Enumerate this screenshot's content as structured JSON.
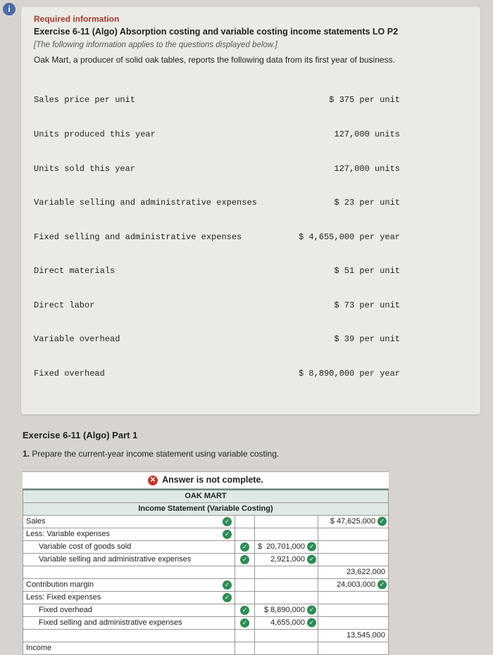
{
  "header": {
    "required": "Required information",
    "title": "Exercise 6-11 (Algo) Absorption costing and variable costing income statements LO P2",
    "note": "[The following information applies to the questions displayed below.]",
    "desc": "Oak Mart, a producer of solid oak tables, reports the following data from its first year of business."
  },
  "data_rows": [
    {
      "label": "Sales price per unit",
      "value": "$ 375 per unit"
    },
    {
      "label": "Units produced this year",
      "value": "127,000 units"
    },
    {
      "label": "Units sold this year",
      "value": "127,000 units"
    },
    {
      "label": "Variable selling and administrative expenses",
      "value": "$ 23 per unit"
    },
    {
      "label": "Fixed selling and administrative expenses",
      "value": "$ 4,655,000 per year"
    },
    {
      "label": "Direct materials",
      "value": "$ 51 per unit"
    },
    {
      "label": "Direct labor",
      "value": "$ 73 per unit"
    },
    {
      "label": "Variable overhead",
      "value": "$ 39 per unit"
    },
    {
      "label": "Fixed overhead",
      "value": "$ 8,890,000 per year"
    }
  ],
  "part": {
    "title": "Exercise 6-11 (Algo) Part 1",
    "num": "1.",
    "text": "Prepare the current-year income statement using variable costing."
  },
  "banner": "Answer is not complete.",
  "table": {
    "h1": "OAK MART",
    "h2": "Income Statement (Variable Costing)",
    "rows": {
      "sales": "Sales",
      "sales_val": "$ 47,625,000",
      "less_var": "Less: Variable expenses",
      "vcogs": "Variable cost of goods sold",
      "vcogs_dollar": "$",
      "vcogs_val": "20,701,000",
      "vsae": "Variable selling and administrative expenses",
      "vsae_val": "2,921,000",
      "var_total": "23,622,000",
      "cm": "Contribution margin",
      "cm_val": "24,003,000",
      "less_fix": "Less: Fixed expenses",
      "foh": "Fixed overhead",
      "foh_val": "$ 8,890,000",
      "fsae": "Fixed selling and administrative expenses",
      "fsae_val": "4,655,000",
      "fix_total": "13,545,000",
      "income": "Income"
    }
  }
}
